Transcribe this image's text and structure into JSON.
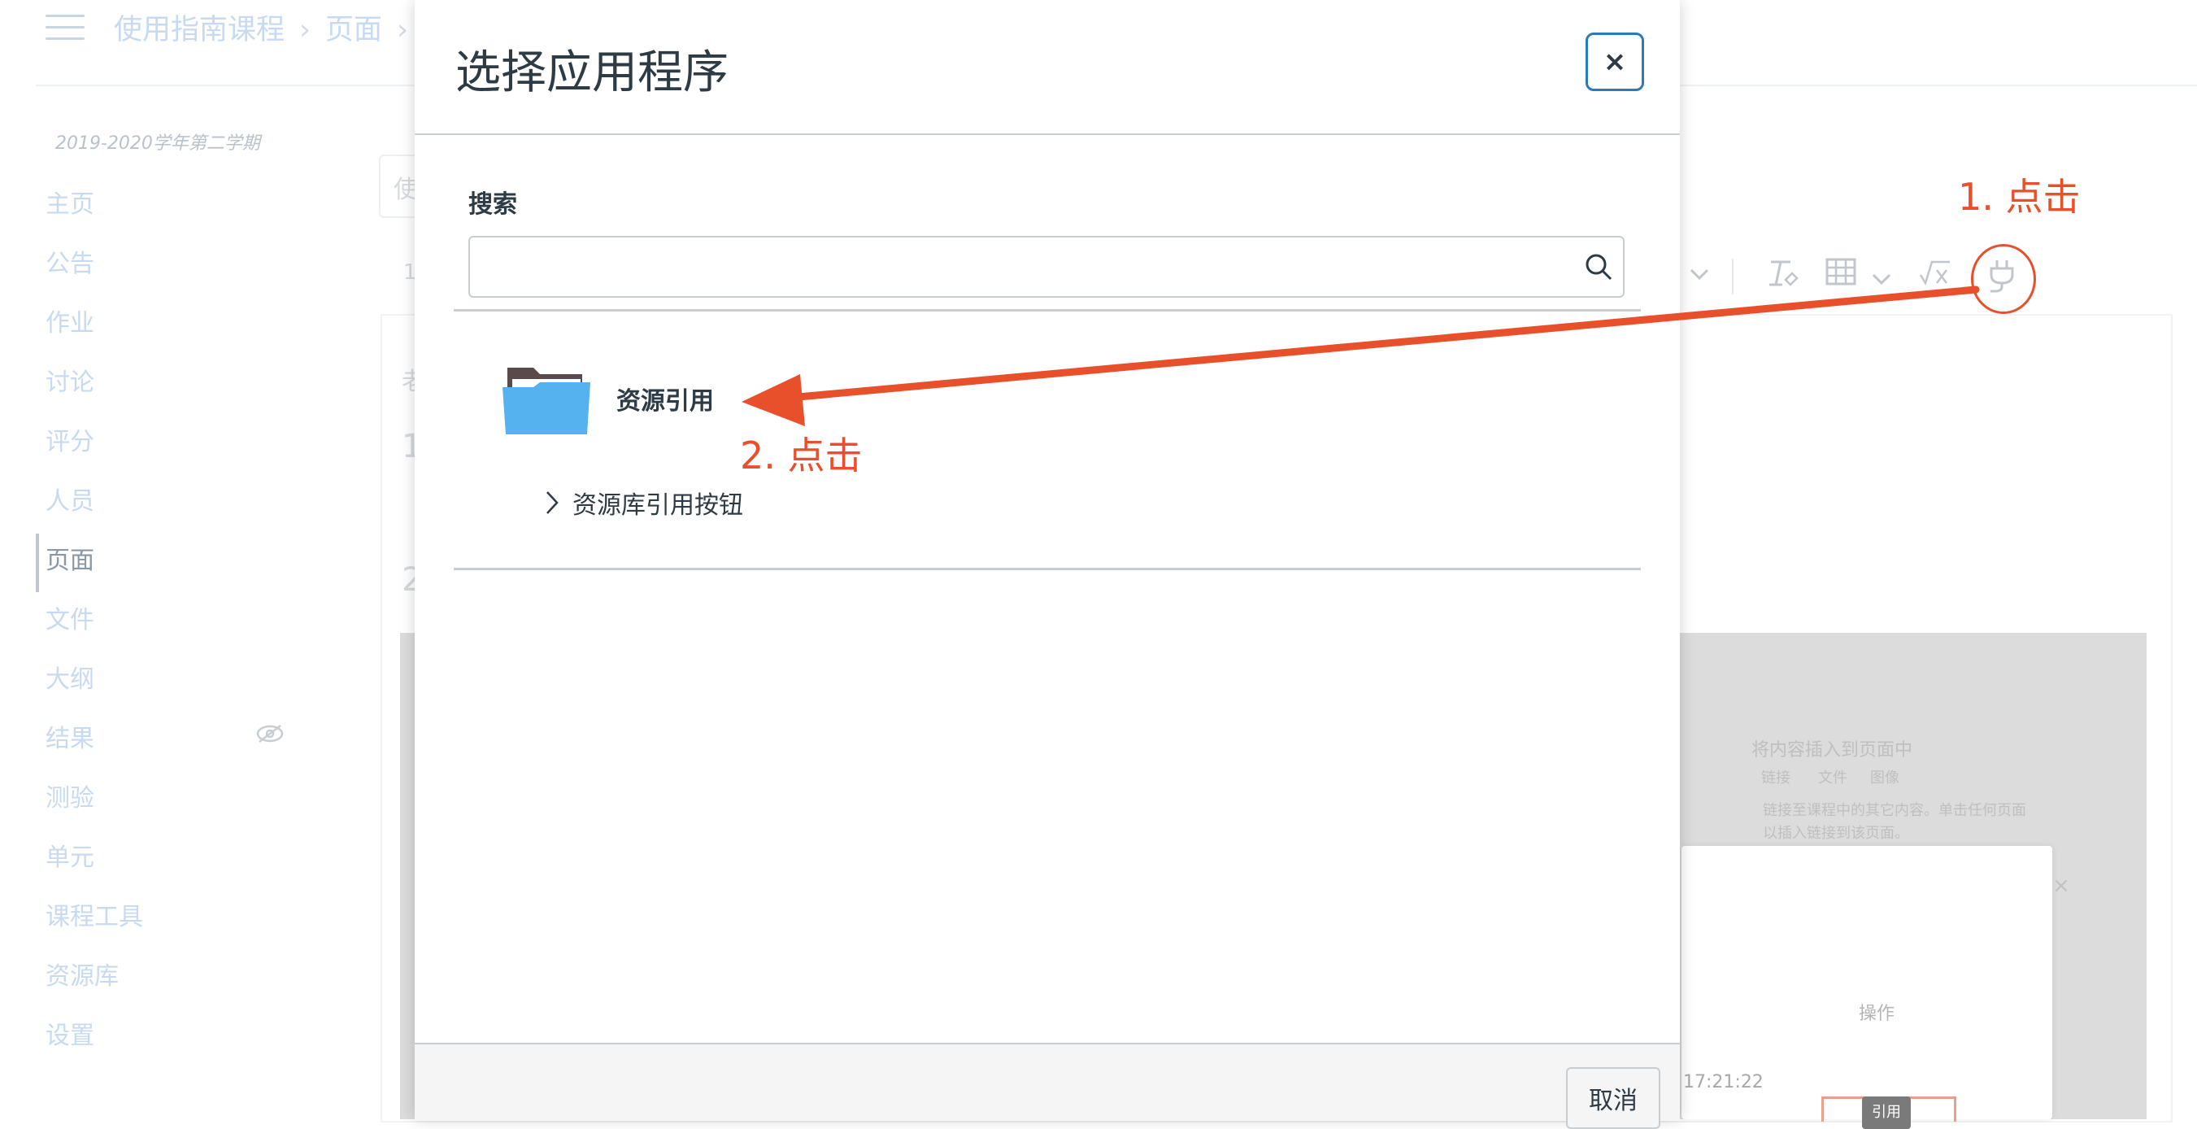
{
  "background": {
    "breadcrumb": [
      "使用指南课程",
      "页面"
    ],
    "breadcrumb_sep": "›",
    "term": "2019-2020学年第二学期",
    "nav": [
      "主页",
      "公告",
      "作业",
      "讨论",
      "评分",
      "人员",
      "页面",
      "文件",
      "大纲",
      "结果",
      "测验",
      "单元",
      "课程工具",
      "资源库",
      "设置"
    ],
    "active_nav": "页面",
    "fragment_input": "使",
    "fragment_row1": "1",
    "fragment_row2": "老",
    "fragment_row3": "1",
    "fragment_row4": "2",
    "ghost_title": "将内容插入到页面中",
    "ghost_tabs": [
      "链接",
      "文件",
      "图像"
    ],
    "ghost_line1": "链接至课程中的其它内容。单击任何页面",
    "ghost_line2": "以插入链接到该页面。",
    "inner_close": "×",
    "op_label": "操作",
    "time_label": "17:21:22",
    "cite_button": "引用"
  },
  "modal": {
    "title": "选择应用程序",
    "close_symbol": "×",
    "search_label": "搜索",
    "search_value": "",
    "app": {
      "name": "资源引用",
      "description": "资源库引用按钮"
    },
    "cancel_label": "取消"
  },
  "annotations": {
    "step1": "1. 点击",
    "step2": "2. 点击",
    "color": "#e8502c"
  }
}
